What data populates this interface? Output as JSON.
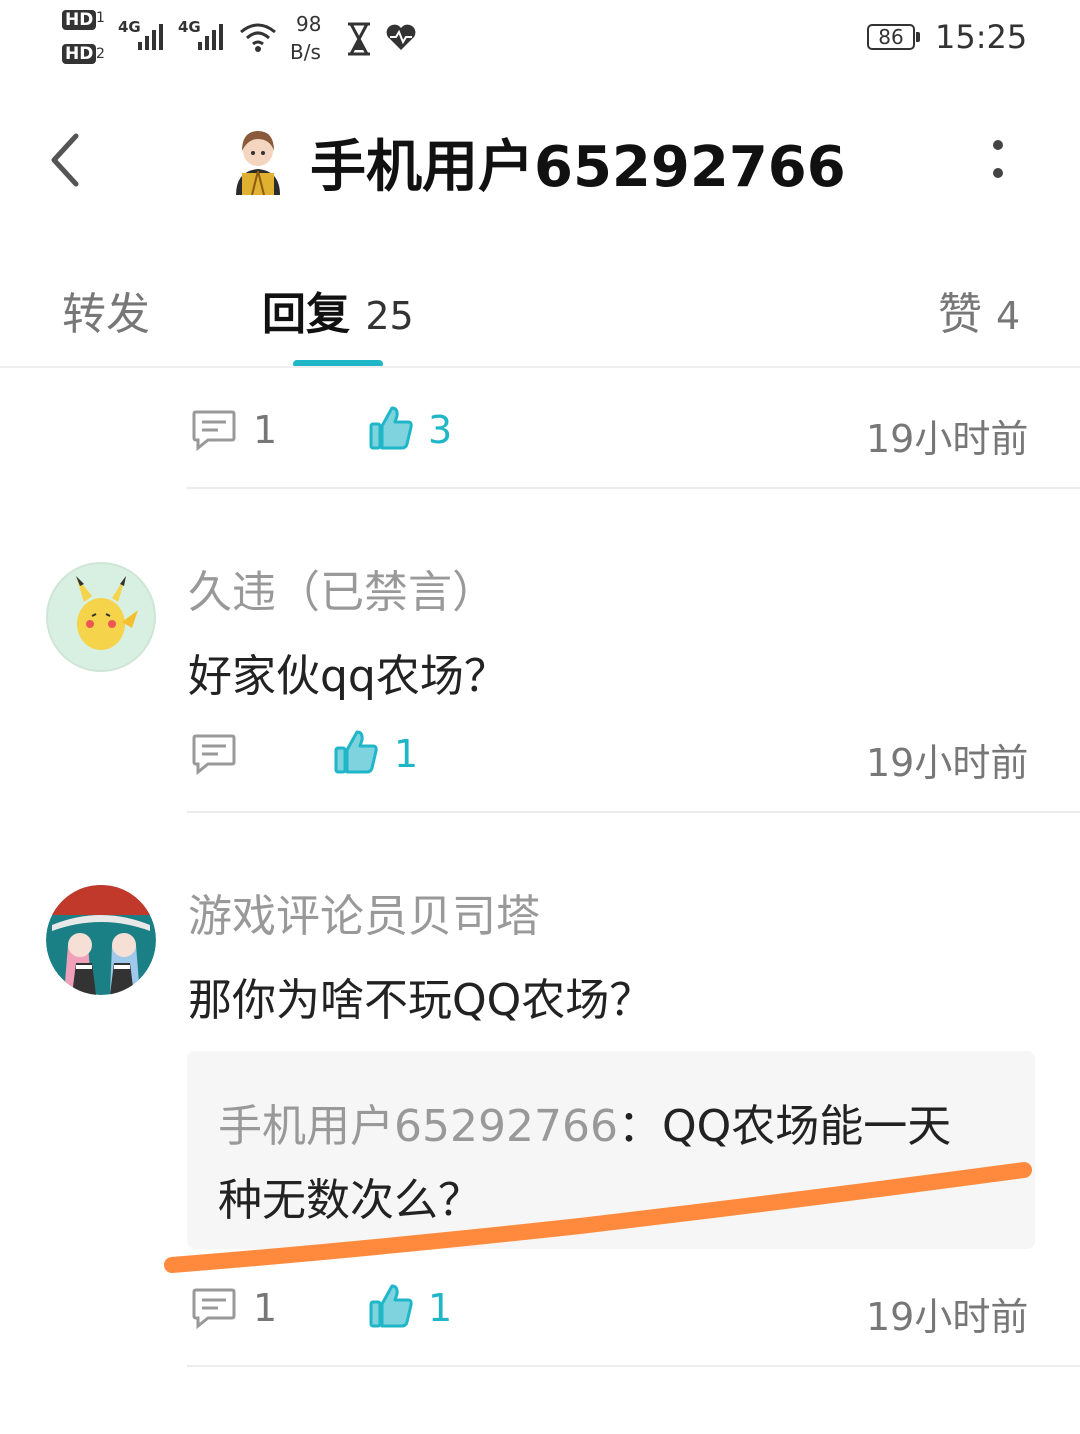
{
  "status_bar": {
    "hd1": "HD",
    "hd2": "HD",
    "sim1": "1",
    "sim2": "2",
    "net1": "4G",
    "net2": "4G",
    "speed_value": "98",
    "speed_unit": "B/s",
    "battery": "86",
    "time": "15:25"
  },
  "header": {
    "title": "手机用户65292766"
  },
  "tabs": [
    {
      "label": "转发",
      "count": ""
    },
    {
      "label": "回复",
      "count": "25"
    },
    {
      "label": "赞",
      "count": "4"
    }
  ],
  "comments": [
    {
      "username": "",
      "content": "",
      "reply_count": "1",
      "like_count": "3",
      "time": "19小时前"
    },
    {
      "username": "久违（已禁言）",
      "content": "好家伙qq农场？",
      "reply_count": "",
      "like_count": "1",
      "time": "19小时前"
    },
    {
      "username": "游戏评论员贝司塔",
      "content": "那你为啥不玩QQ农场？",
      "quote": {
        "name": "手机用户65292766",
        "separator": "：",
        "text_line1": "QQ农场能一天",
        "text_line2": "种无数次么？"
      },
      "reply_count": "1",
      "like_count": "1",
      "time": "19小时前"
    }
  ],
  "colors": {
    "accent": "#1fb6c8",
    "annotation": "#ff8a3d"
  }
}
